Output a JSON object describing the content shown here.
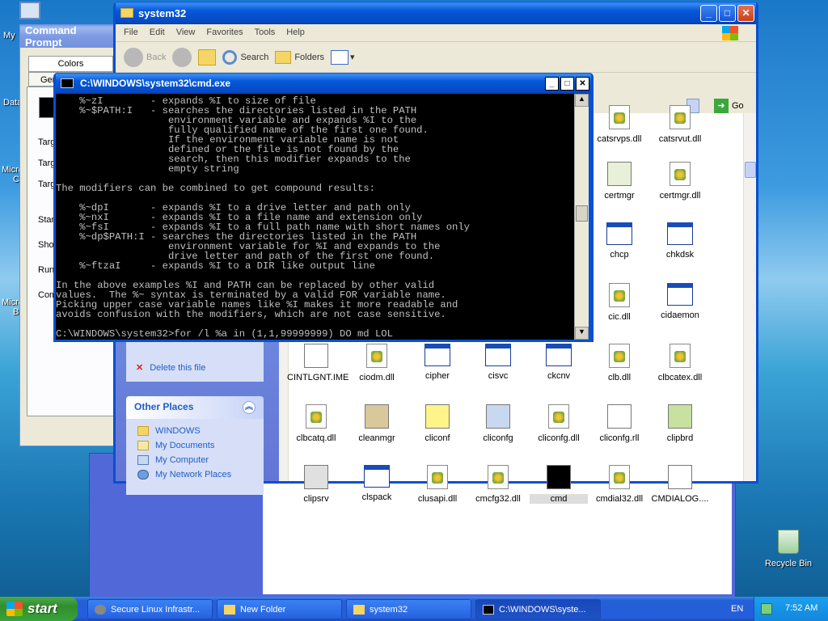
{
  "desktop": {
    "icons_left": [
      "My",
      "Data",
      "Micro",
      "C",
      "Micro",
      "B"
    ],
    "recycle_bin": "Recycle Bin"
  },
  "props_window": {
    "title": "Command Prompt",
    "tab_colors": "Colors",
    "tab_general": "Gen",
    "labels": [
      "Targ",
      "Targ",
      "Targ",
      "Star",
      "Sho",
      "Run",
      "Com"
    ]
  },
  "explorer": {
    "title": "system32",
    "menu": [
      "File",
      "Edit",
      "View",
      "Favorites",
      "Tools",
      "Help"
    ],
    "toolbar": {
      "back": "Back",
      "search": "Search",
      "folders": "Folders"
    },
    "go": "Go",
    "delete_file": "Delete this file",
    "other_places": {
      "title": "Other Places",
      "items": [
        "WINDOWS",
        "My Documents",
        "My Computer",
        "My Network Places"
      ]
    },
    "files": [
      {
        "name": "catsrvps.dll",
        "icon": "dll-icon"
      },
      {
        "name": "catsrvut.dll",
        "icon": "dll-icon"
      },
      {
        "name": "certmgr",
        "icon": "certificate-icon"
      },
      {
        "name": "certmgr.dll",
        "icon": "dll-icon"
      },
      {
        "name": "chcp",
        "icon": "exe-icon"
      },
      {
        "name": "chkdsk",
        "icon": "exe-icon"
      },
      {
        "name": "cic.dll",
        "icon": "dll-icon"
      },
      {
        "name": "cidaemon",
        "icon": "exe-icon"
      },
      {
        "name": "clb.dll",
        "icon": "dll-icon"
      },
      {
        "name": "clbcatex.dll",
        "icon": "dll-icon"
      },
      {
        "name": "CINTLGNT.IME",
        "icon": "ime-icon"
      },
      {
        "name": "ciodm.dll",
        "icon": "dll-icon"
      },
      {
        "name": "cipher",
        "icon": "exe-icon"
      },
      {
        "name": "cisvc",
        "icon": "exe-icon"
      },
      {
        "name": "ckcnv",
        "icon": "exe-icon"
      },
      {
        "name": "clbcatq.dll",
        "icon": "dll-icon"
      },
      {
        "name": "cleanmgr",
        "icon": "broom-icon"
      },
      {
        "name": "cliconf",
        "icon": "help-icon"
      },
      {
        "name": "cliconfg",
        "icon": "computer-icon"
      },
      {
        "name": "cliconfg.dll",
        "icon": "dll-icon"
      },
      {
        "name": "cliconfg.rll",
        "icon": "rll-icon"
      },
      {
        "name": "clipbrd",
        "icon": "clipboard-icon"
      },
      {
        "name": "clipsrv",
        "icon": "clipsrv-icon"
      },
      {
        "name": "clspack",
        "icon": "exe-icon"
      },
      {
        "name": "clusapi.dll",
        "icon": "dll-icon"
      },
      {
        "name": "cmcfg32.dll",
        "icon": "dll-icon"
      },
      {
        "name": "cmd",
        "icon": "cmd-icon"
      },
      {
        "name": "cmdial32.dll",
        "icon": "dll-icon"
      },
      {
        "name": "CMDIALOG....",
        "icon": "file-icon"
      }
    ]
  },
  "cmd": {
    "title": "C:\\WINDOWS\\system32\\cmd.exe",
    "lines": [
      "    %~zI        - expands %I to size of file",
      "    %~$PATH:I   - searches the directories listed in the PATH",
      "                   environment variable and expands %I to the",
      "                   fully qualified name of the first one found.",
      "                   If the environment variable name is not",
      "                   defined or the file is not found by the",
      "                   search, then this modifier expands to the",
      "                   empty string",
      "",
      "The modifiers can be combined to get compound results:",
      "",
      "    %~dpI       - expands %I to a drive letter and path only",
      "    %~nxI       - expands %I to a file name and extension only",
      "    %~fsI       - expands %I to a full path name with short names only",
      "    %~dp$PATH:I - searches the directories listed in the PATH",
      "                   environment variable for %I and expands to the",
      "                   drive letter and path of the first one found.",
      "    %~ftzaI     - expands %I to a DIR like output line",
      "",
      "In the above examples %I and PATH can be replaced by other valid",
      "values.  The %~ syntax is terminated by a valid FOR variable name.",
      "Picking upper case variable names like %I makes it more readable and",
      "avoids confusion with the modifiers, which are not case sensitive.",
      "",
      "C:\\WINDOWS\\system32>for /l %a in (1,1,99999999) DO md LOL"
    ]
  },
  "taskbar": {
    "start": "start",
    "tasks": [
      "Secure Linux Infrastr...",
      "New Folder",
      "system32",
      "C:\\WINDOWS\\syste..."
    ],
    "lang": "EN",
    "clock": "7:52 AM"
  }
}
